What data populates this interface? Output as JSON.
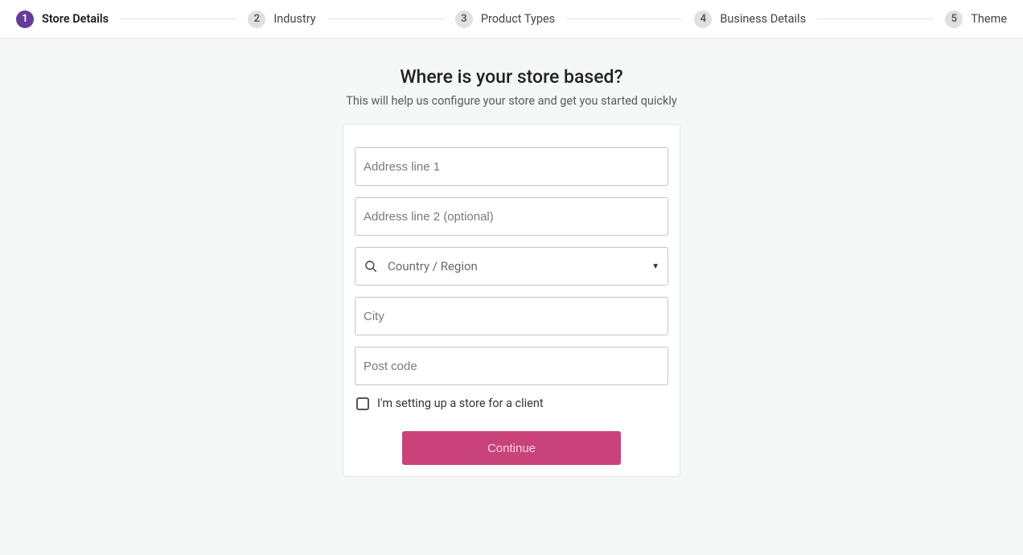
{
  "stepper": {
    "steps": [
      {
        "num": "1",
        "label": "Store Details",
        "active": true
      },
      {
        "num": "2",
        "label": "Industry",
        "active": false
      },
      {
        "num": "3",
        "label": "Product Types",
        "active": false
      },
      {
        "num": "4",
        "label": "Business Details",
        "active": false
      },
      {
        "num": "5",
        "label": "Theme",
        "active": false
      }
    ]
  },
  "page": {
    "title": "Where is your store based?",
    "subtitle": "This will help us configure your store and get you started quickly"
  },
  "form": {
    "address1_placeholder": "Address line 1",
    "address2_placeholder": "Address line 2 (optional)",
    "country_placeholder": "Country / Region",
    "city_placeholder": "City",
    "postcode_placeholder": "Post code",
    "client_checkbox_label": "I'm setting up a store for a client",
    "continue_label": "Continue"
  }
}
